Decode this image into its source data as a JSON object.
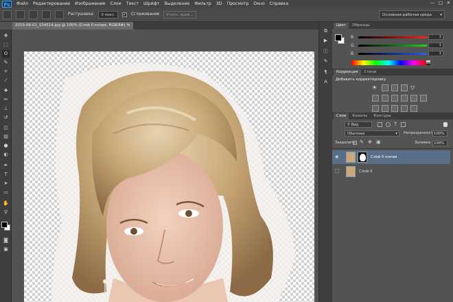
{
  "app": {
    "logo": "Ps"
  },
  "menu": [
    "Файл",
    "Редактирование",
    "Изображение",
    "Слои",
    "Текст",
    "Шрифт",
    "Выделение",
    "Фильтр",
    "3D",
    "Просмотр",
    "Окно",
    "Справка"
  ],
  "window_controls": [
    "—",
    "□",
    "✕"
  ],
  "options": {
    "feather_label": "Растушевка:",
    "feather_value": "0 пикс.",
    "antialias_label": "Сглаживание",
    "refine_label": "Уточн. край...",
    "workspace": "Основная рабочая среда"
  },
  "document_tab": {
    "title": "2015-06-01_154514.jpg @ 100% (Слой 0 копия, RGB/8#) *",
    "close": "×"
  },
  "color_panel": {
    "tabs": [
      "Цвет",
      "Образцы"
    ],
    "channels": [
      {
        "label": "R",
        "value": "1",
        "color": "#d43a3a"
      },
      {
        "label": "G",
        "value": "1",
        "color": "#3ab23a"
      },
      {
        "label": "B",
        "value": "1",
        "color": "#3a6ad4"
      }
    ]
  },
  "adjustments_panel": {
    "tabs": [
      "Коррекция",
      "Стили"
    ],
    "title": "Добавить корректировку"
  },
  "layers_panel": {
    "tabs": [
      "Слои",
      "Каналы",
      "Контуры"
    ],
    "filter_label": "Вид",
    "blend_mode": "Обычные",
    "opacity_label": "Непрозрачность:",
    "opacity_value": "100%",
    "lock_label": "Закрепить:",
    "fill_label": "Заливка:",
    "fill_value": "100%",
    "layers": [
      {
        "name": "Слой 0 копия",
        "visible": true,
        "selected": true,
        "has_mask": true
      },
      {
        "name": "Слой 0",
        "visible": false,
        "selected": false,
        "has_mask": false
      }
    ]
  },
  "tools": [
    "move-tool",
    "marquee-tool",
    "lasso-tool",
    "quick-select-tool",
    "crop-tool",
    "eyedropper-tool",
    "healing-tool",
    "brush-tool",
    "clone-tool",
    "history-brush-tool",
    "eraser-tool",
    "gradient-tool",
    "blur-tool",
    "dodge-tool",
    "pen-tool",
    "type-tool",
    "path-select-tool",
    "shape-tool",
    "hand-tool",
    "zoom-tool"
  ]
}
